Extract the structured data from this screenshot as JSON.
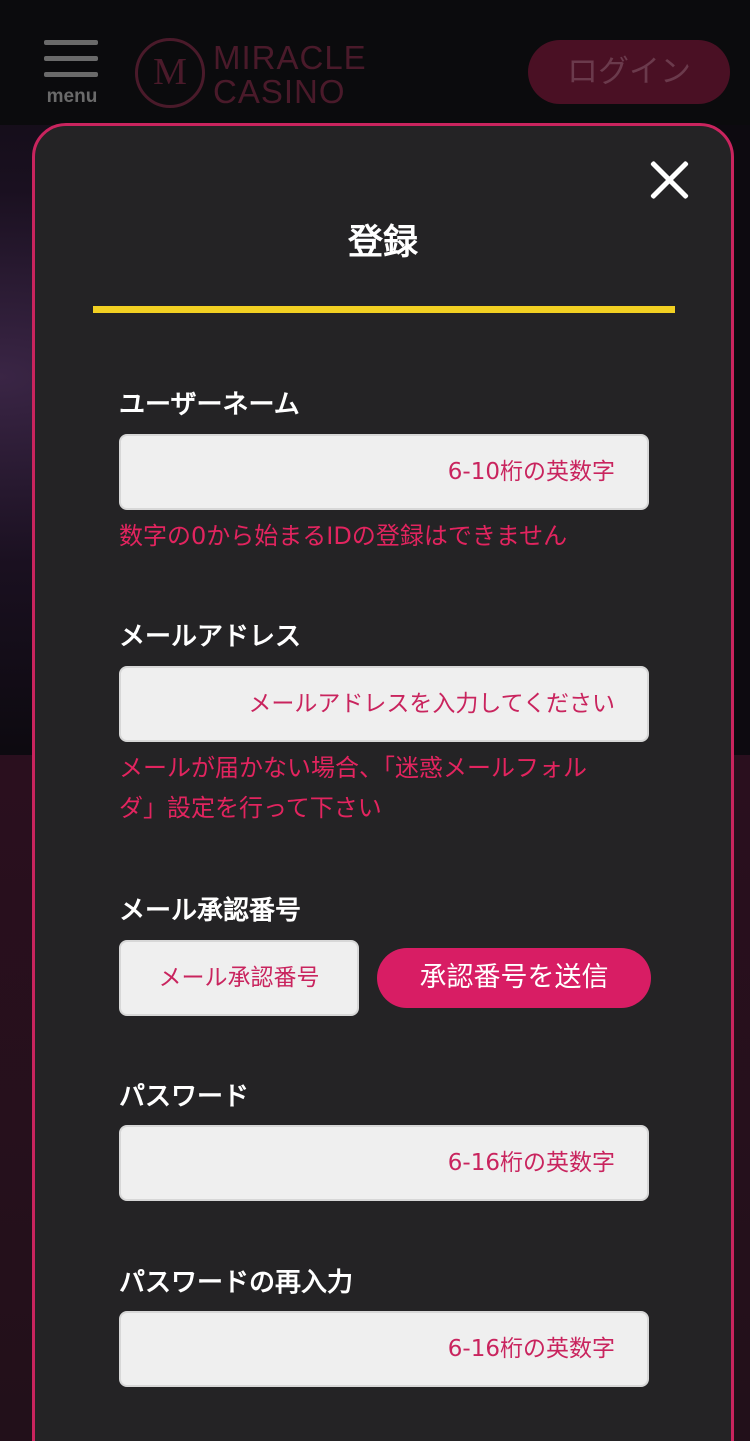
{
  "header": {
    "menu_label": "menu",
    "logo_letter": "M",
    "logo_line1": "MIRACLE",
    "logo_line2": "CASINO",
    "login_label": "ログイン"
  },
  "modal": {
    "title": "登録",
    "close_icon": "close-icon",
    "username": {
      "label": "ユーザーネーム",
      "placeholder": "6-10桁の英数字",
      "note": "数字の0から始まるIDの登録はできません"
    },
    "email": {
      "label": "メールアドレス",
      "placeholder": "メールアドレスを入力してください",
      "note_line1": "メールが届かない場合、「迷惑メールフォル",
      "note_line2": "ダ」設定を行って下さい"
    },
    "verification": {
      "label": "メール承認番号",
      "placeholder": "メール承認番号",
      "send_label": "承認番号を送信"
    },
    "password": {
      "label": "パスワード",
      "placeholder": "6-16桁の英数字"
    },
    "password_confirm": {
      "label": "パスワードの再入力",
      "placeholder": "6-16桁の英数字"
    }
  },
  "colors": {
    "accent": "#d81d64",
    "modal_border": "#c9245e",
    "title_underline": "#f2d022",
    "modal_bg": "#242325"
  }
}
